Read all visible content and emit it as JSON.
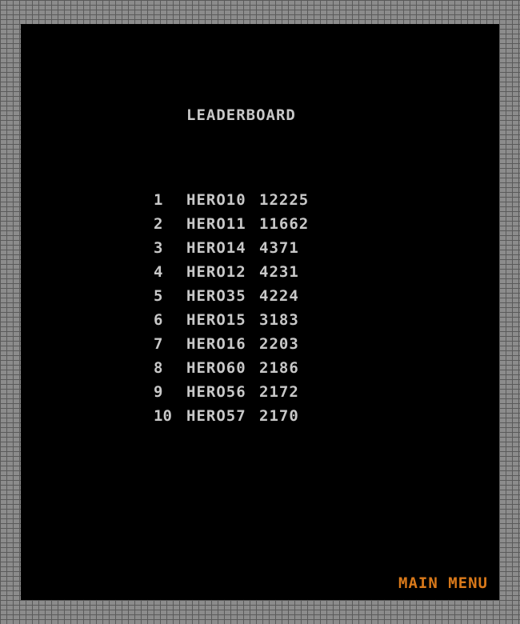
{
  "title": "LEADERBOARD",
  "entries": [
    {
      "rank": "1",
      "name": "HERO10",
      "score": "12225"
    },
    {
      "rank": "2",
      "name": "HERO11",
      "score": "11662"
    },
    {
      "rank": "3",
      "name": "HERO14",
      "score": "4371"
    },
    {
      "rank": "4",
      "name": "HERO12",
      "score": "4231"
    },
    {
      "rank": "5",
      "name": "HERO35",
      "score": "4224"
    },
    {
      "rank": "6",
      "name": "HERO15",
      "score": "3183"
    },
    {
      "rank": "7",
      "name": "HERO16",
      "score": "2203"
    },
    {
      "rank": "8",
      "name": "HERO60",
      "score": "2186"
    },
    {
      "rank": "9",
      "name": "HERO56",
      "score": "2172"
    },
    {
      "rank": "10",
      "name": "HERO57",
      "score": "2170"
    }
  ],
  "main_menu_label": "MAIN MENU",
  "colors": {
    "text": "#c8c8c8",
    "accent": "#d9791a",
    "background": "#000000",
    "border_brick": "#8c8c8c"
  }
}
